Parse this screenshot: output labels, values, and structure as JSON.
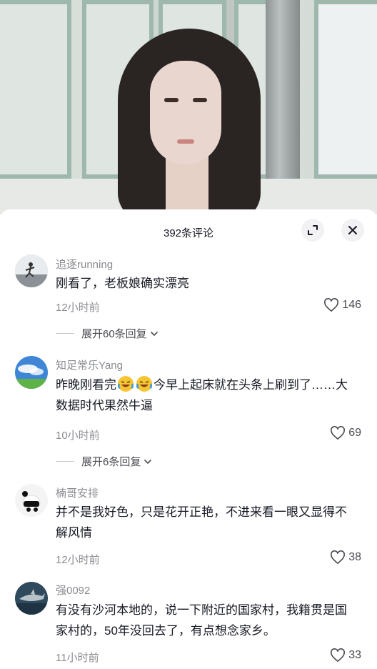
{
  "header": {
    "title": "392条评论"
  },
  "comments": [
    {
      "username": "追逐running",
      "text": "刚看了，老板娘确实漂亮",
      "time": "12小时前",
      "likes": "146",
      "expand": "展开60条回复"
    },
    {
      "username": "知足常乐Yang",
      "text_a": "昨晚刚看完",
      "text_b": "今早上起床就在头条上刷到了……大数据时代果然牛逼",
      "time": "10小时前",
      "likes": "69",
      "expand": "展开6条回复"
    },
    {
      "username": "楠哥安排",
      "text": "并不是我好色，只是花开正艳，不进来看一眼又显得不解风情",
      "time": "12小时前",
      "likes": "38"
    },
    {
      "username": "强0092",
      "text": "有没有沙河本地的，说一下附近的国家村，我籍贯是国家村的，50年没回去了，有点想念家乡。",
      "time": "11小时前",
      "likes": "33"
    }
  ],
  "icons": {
    "expand_view": "expand-arrows-icon",
    "close": "close-icon",
    "like": "heart-outline-icon",
    "chevron": "chevron-down-icon",
    "emoji": "laughing-crying-emoji"
  }
}
